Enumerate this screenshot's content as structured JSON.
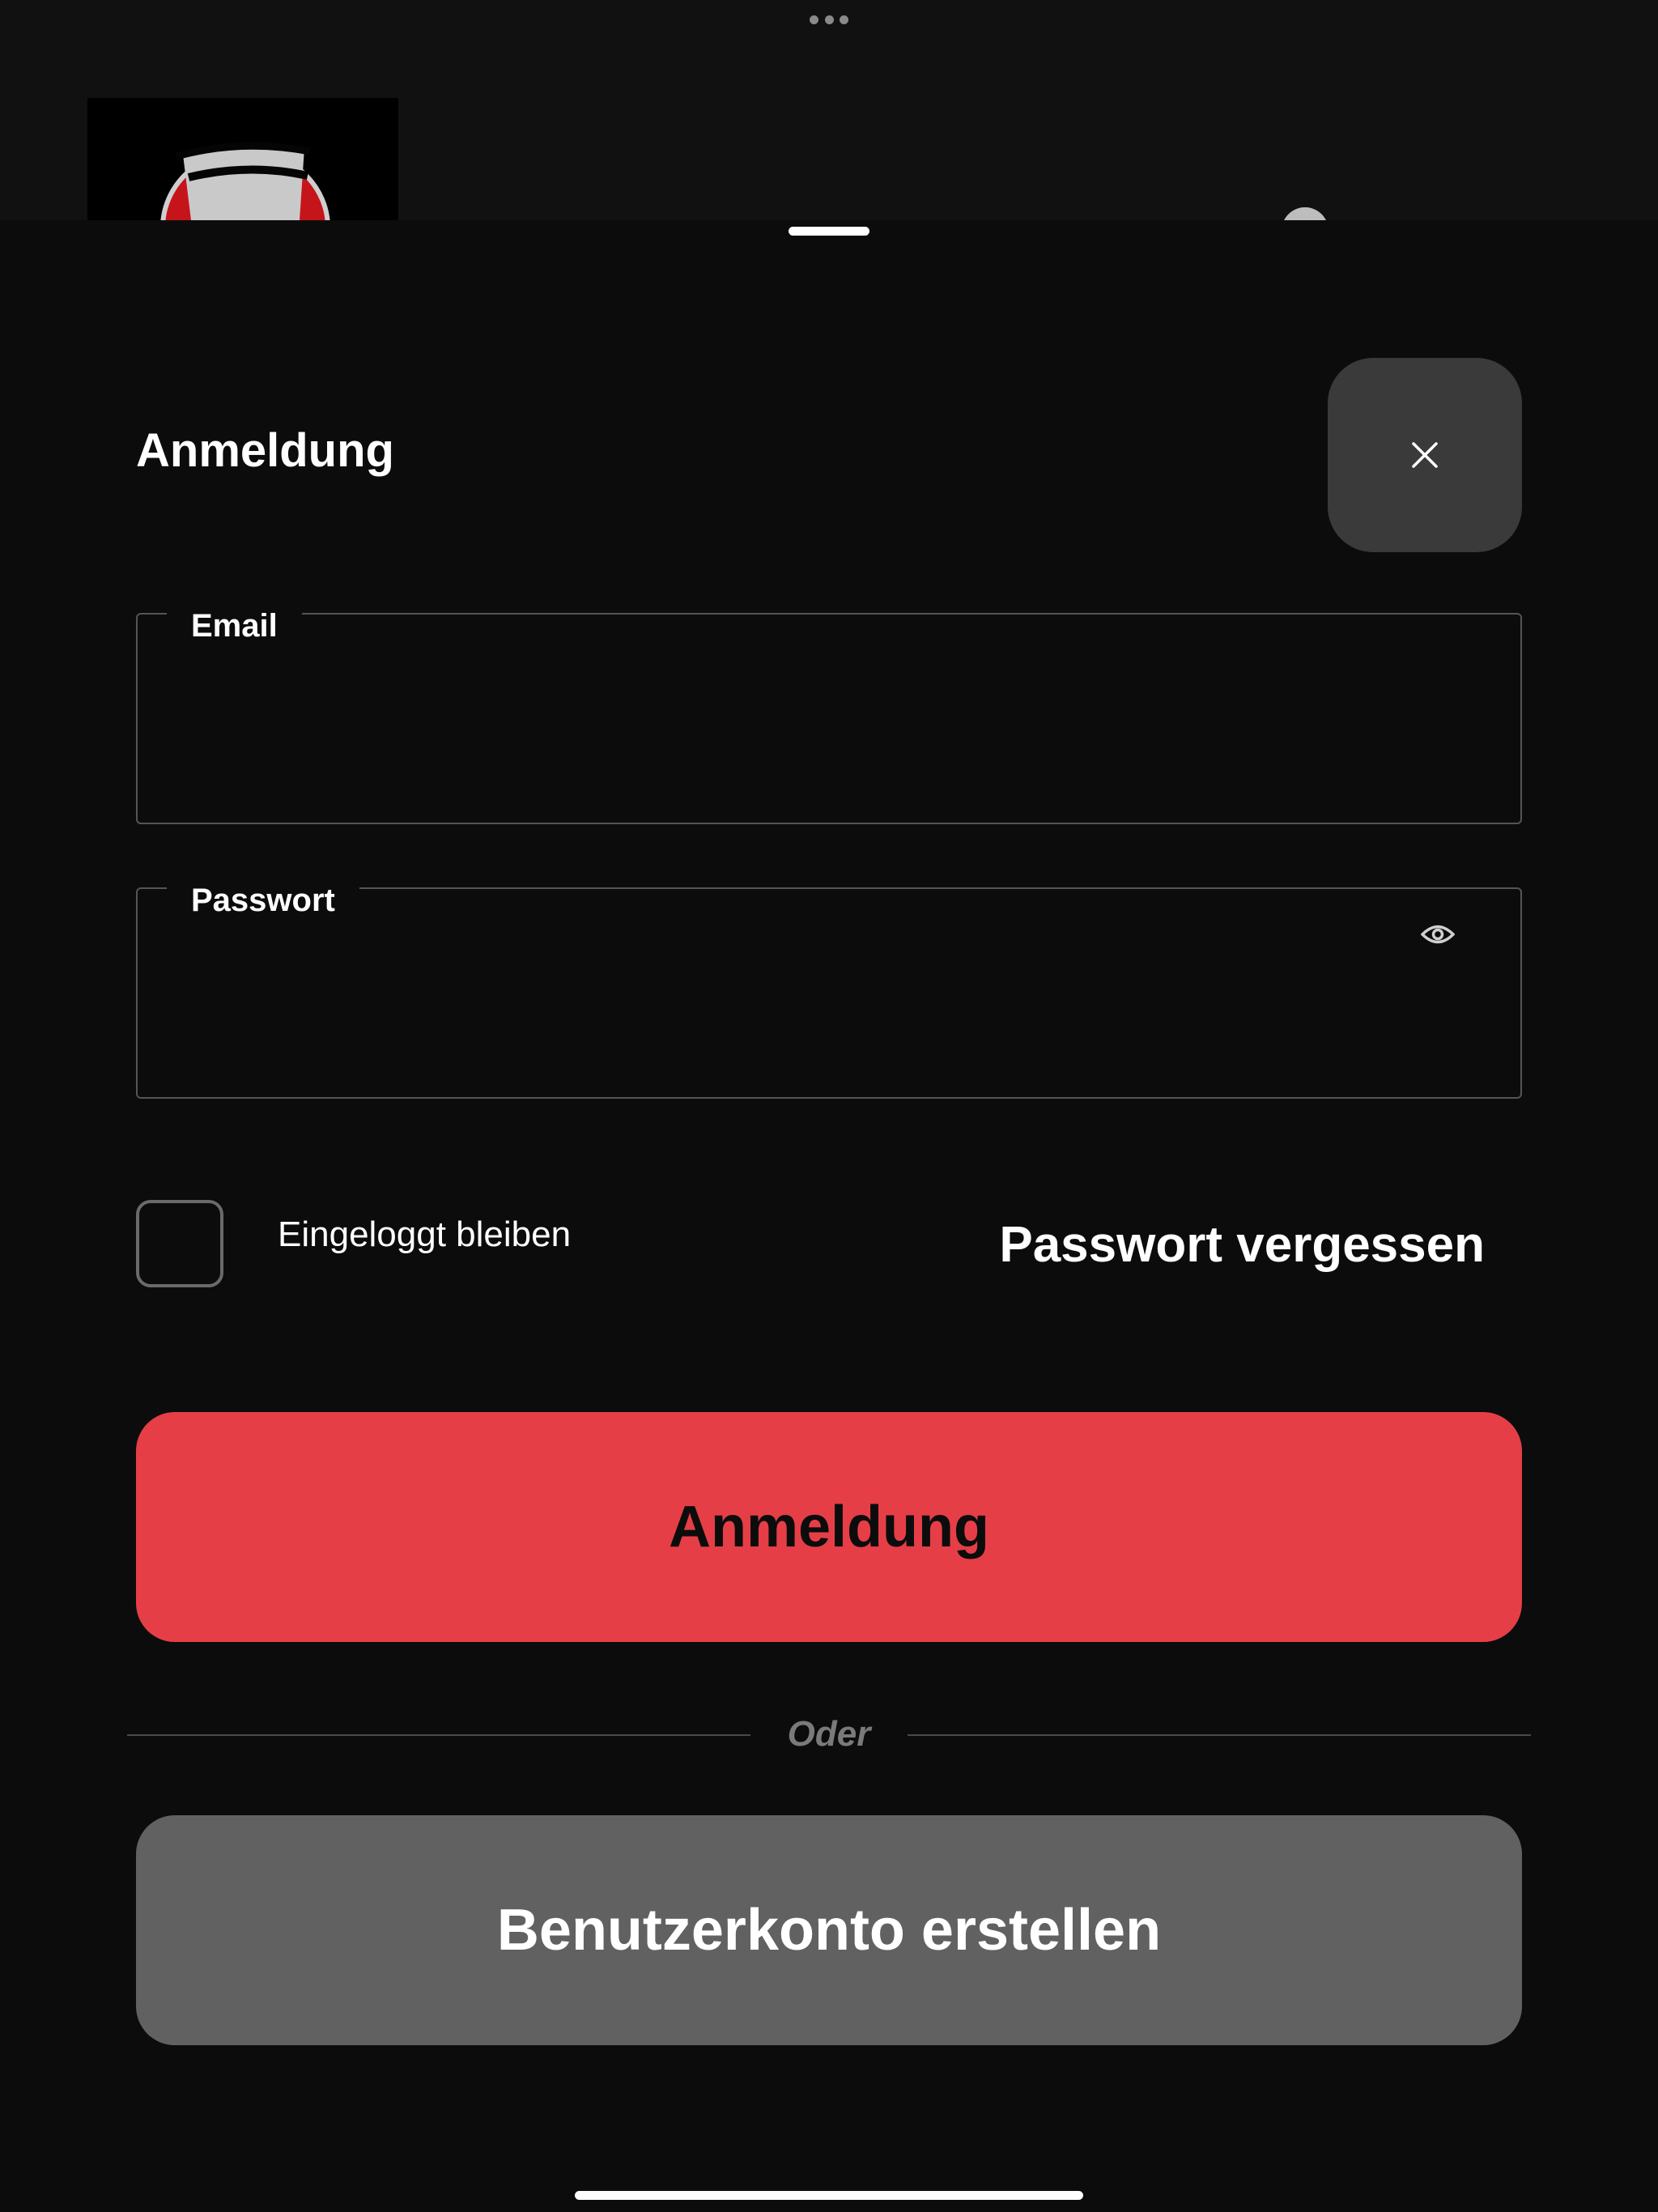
{
  "sheet": {
    "title": "Anmeldung",
    "close_icon": "close-icon"
  },
  "form": {
    "email": {
      "label": "Email",
      "value": "",
      "placeholder": ""
    },
    "password": {
      "label": "Passwort",
      "value": "",
      "placeholder": "",
      "toggle_icon": "eye-icon"
    },
    "remember": {
      "label": "Eingeloggt bleiben",
      "checked": false
    },
    "forgot_password": "Passwort vergessen"
  },
  "actions": {
    "login_label": "Anmeldung",
    "divider_label": "Oder",
    "create_account_label": "Benutzerkonto erstellen"
  },
  "colors": {
    "background": "#0c0c0c",
    "primary_button": "#e63e46",
    "secondary_button": "#616161",
    "close_button": "#3a3a3a"
  }
}
